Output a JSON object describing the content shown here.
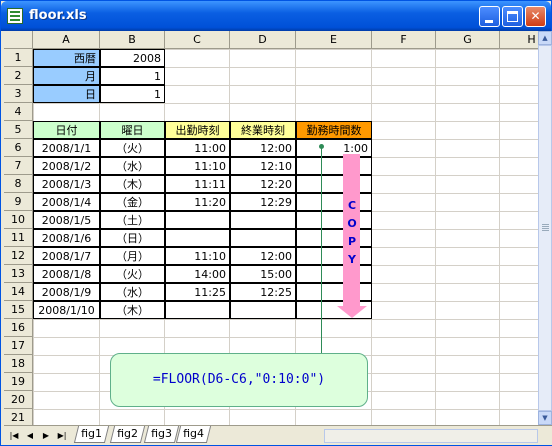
{
  "window": {
    "title": "floor.xls",
    "min": "_",
    "max": "□",
    "close": "✕"
  },
  "columns": [
    "A",
    "B",
    "C",
    "D",
    "E",
    "F",
    "G",
    "H"
  ],
  "rows": [
    "1",
    "2",
    "3",
    "4",
    "5",
    "6",
    "7",
    "8",
    "9",
    "10",
    "11",
    "12",
    "13",
    "14",
    "15",
    "16",
    "17",
    "18",
    "19",
    "20",
    "21"
  ],
  "params": [
    {
      "label": "西暦",
      "value": "2008"
    },
    {
      "label": "月",
      "value": "1"
    },
    {
      "label": "日",
      "value": "1"
    }
  ],
  "table": {
    "headers": [
      "日付",
      "曜日",
      "出勤時刻",
      "終業時刻",
      "勤務時間数"
    ],
    "rows": [
      [
        "2008/1/1",
        "（火）",
        "11:00",
        "12:00",
        "1:00"
      ],
      [
        "2008/1/2",
        "（水）",
        "11:10",
        "12:10",
        ""
      ],
      [
        "2008/1/3",
        "（木）",
        "11:11",
        "12:20",
        ""
      ],
      [
        "2008/1/4",
        "（金）",
        "11:20",
        "12:29",
        ""
      ],
      [
        "2008/1/5",
        "（土）",
        "",
        "",
        ""
      ],
      [
        "2008/1/6",
        "（日）",
        "",
        "",
        ""
      ],
      [
        "2008/1/7",
        "（月）",
        "11:10",
        "12:00",
        ""
      ],
      [
        "2008/1/8",
        "（火）",
        "14:00",
        "15:00",
        ""
      ],
      [
        "2008/1/9",
        "（水）",
        "11:25",
        "12:25",
        ""
      ],
      [
        "2008/1/10",
        "（木）",
        "",
        "",
        ""
      ]
    ]
  },
  "copy_letters": [
    "C",
    "O",
    "P",
    "Y"
  ],
  "formula": "=FLOOR(D6-C6,\"0:10:0\")",
  "sheet_tabs": [
    "fig1",
    "fig2",
    "fig3",
    "fig4"
  ],
  "active_tab": "fig2",
  "colors": {
    "param_fill": "#99ccff",
    "header_green": "#ccffcc",
    "header_yellow": "#ffff99",
    "header_orange": "#ff9900",
    "arrow": "#ff99cc",
    "formula_fill": "#ddffdd"
  }
}
